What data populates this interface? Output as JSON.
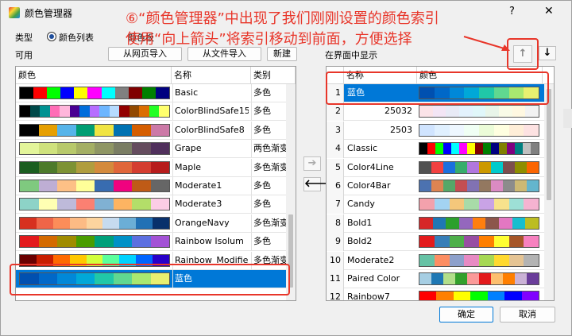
{
  "window": {
    "title": "颜色管理器",
    "help": "?",
    "close": "✕"
  },
  "annotation": {
    "line1": "⑥“颜色管理器”中出现了我们刚刚设置的颜色索引",
    "line2": "使用“向上箭头”将索引移动到前面，方便选择",
    "accent": "#e8362a"
  },
  "type_label": "类型",
  "radio_list": "颜色列表",
  "radio_board": "颜色板",
  "available_label": "可用",
  "buttons": {
    "import_web": "从网页导入",
    "import_file": "从文件导入",
    "new": "新建",
    "ok": "确定",
    "cancel": "取消"
  },
  "display_label": "在界面中显示",
  "left_table": {
    "headers": [
      "颜色",
      "名称",
      "类别"
    ],
    "rows": [
      {
        "name": "Basic",
        "cat": "多色",
        "colors": [
          "#000000",
          "#ff0000",
          "#00ff00",
          "#0000ff",
          "#ffff00",
          "#ff00ff",
          "#00ffff",
          "#808080",
          "#800000",
          "#008000",
          "#000080"
        ]
      },
      {
        "name": "ColorBlindSafe15",
        "cat": "多色",
        "colors": [
          "#000000",
          "#004949",
          "#009292",
          "#ff6db6",
          "#ffb6db",
          "#490092",
          "#006ddb",
          "#b66dff",
          "#6db6ff",
          "#b6dbff",
          "#920000",
          "#924900",
          "#db6d00",
          "#24ff24",
          "#ffff6d"
        ]
      },
      {
        "name": "ColorBlindSafe8",
        "cat": "多色",
        "colors": [
          "#000000",
          "#e69f00",
          "#56b4e9",
          "#009e73",
          "#f0e442",
          "#0072b2",
          "#d55e00",
          "#cc79a7"
        ]
      },
      {
        "name": "Grape",
        "cat": "两色渐变",
        "colors": [
          "#e3f59a",
          "#cfe27d",
          "#b8c96b",
          "#a4af64",
          "#8f9664",
          "#7a7d63",
          "#654c5e",
          "#50305c"
        ]
      },
      {
        "name": "Maple",
        "cat": "多色渐变",
        "colors": [
          "#1b5e20",
          "#4c7a2a",
          "#7d9234",
          "#b09d3e",
          "#d48a3c",
          "#e0663a",
          "#d43d30",
          "#b71c1c"
        ]
      },
      {
        "name": "Moderate1",
        "cat": "多色",
        "colors": [
          "#7fc97f",
          "#beaed4",
          "#fdc086",
          "#ffff99",
          "#386cb0",
          "#f0027f",
          "#bf5b17",
          "#666666"
        ]
      },
      {
        "name": "Moderate3",
        "cat": "多色",
        "colors": [
          "#8dd3c7",
          "#ffffb3",
          "#bebada",
          "#fb8072",
          "#80b1d3",
          "#fdb462",
          "#b3de69",
          "#fccde5"
        ]
      },
      {
        "name": "OrangeNavy",
        "cat": "多色渐变",
        "colors": [
          "#d7301f",
          "#ef6548",
          "#fc8d59",
          "#fdbb84",
          "#fdd49e",
          "#c6dbef",
          "#6baed6",
          "#2171b5",
          "#08306b"
        ]
      },
      {
        "name": "Rainbow Isolum",
        "cat": "多色",
        "colors": [
          "#e31a1c",
          "#d46a00",
          "#a08c00",
          "#4a9d00",
          "#00a07a",
          "#0091c7",
          "#5c6fe0",
          "#a352d6"
        ]
      },
      {
        "name": "Rainbow_Modified",
        "cat": "多色渐变",
        "colors": [
          "#6a0000",
          "#c81e00",
          "#ff6a00",
          "#ffc800",
          "#d2ff3c",
          "#5cff9c",
          "#00d2ff",
          "#0064ff",
          "#2800c8"
        ]
      },
      {
        "name": "蓝色",
        "cat": "",
        "selected": true,
        "colors": [
          "#0050b0",
          "#0068c8",
          "#0088d8",
          "#00a8d8",
          "#20c8a8",
          "#60d890",
          "#a8e870",
          "#e8f070"
        ]
      }
    ]
  },
  "right_table": {
    "headers": [
      "名称",
      "颜色"
    ],
    "rows": [
      {
        "idx": "1",
        "name": "蓝色",
        "selected": true,
        "colors": [
          "#0050b0",
          "#0068c8",
          "#0088d8",
          "#00a8d8",
          "#20c8a8",
          "#60d890",
          "#a8e870",
          "#e8f070"
        ]
      },
      {
        "idx": "2",
        "name": "25032",
        "right": true,
        "colors": [
          "#fbe3e8",
          "#f3e5f5",
          "#e8eaf6",
          "#e3f2fd",
          "#e0f7fa",
          "#e8f5e9",
          "#f9fbe7",
          "#fff8e1",
          "#f2f2f2"
        ]
      },
      {
        "idx": "3",
        "name": "2503",
        "right": true,
        "colors": [
          "#d0e4ff",
          "#e0f0ff",
          "#eef7ff",
          "#f0fff4",
          "#ecfcd8",
          "#ffffe0",
          "#ffeed8",
          "#fde2e2"
        ]
      },
      {
        "idx": "4",
        "name": "Classic",
        "colors": [
          "#000000",
          "#ff0000",
          "#00ff00",
          "#0000ff",
          "#00ffff",
          "#ff00ff",
          "#ffff00",
          "#800000",
          "#008000",
          "#000080",
          "#808000",
          "#800080",
          "#008080",
          "#c0c0c0",
          "#808080"
        ]
      },
      {
        "idx": "5",
        "name": "Color4Line",
        "colors": [
          "#515151",
          "#f14040",
          "#1a6fdf",
          "#37ad6b",
          "#b177de",
          "#cc9900",
          "#00cbcc",
          "#7d4e4e",
          "#8e8e00",
          "#fb6501"
        ]
      },
      {
        "idx": "6",
        "name": "Color4Bar",
        "colors": [
          "#4c72b0",
          "#dd8452",
          "#55a868",
          "#c44e52",
          "#8172b3",
          "#937860",
          "#da8bc3",
          "#8c8c8c",
          "#ccb974",
          "#64b5cd"
        ]
      },
      {
        "idx": "7",
        "name": "Candy",
        "colors": [
          "#f3a1ac",
          "#a3d3f2",
          "#f4c77b",
          "#a8dba8",
          "#c9a3e6",
          "#f7e28c",
          "#9de0d6",
          "#f5b3d1"
        ]
      },
      {
        "idx": "8",
        "name": "Bold1",
        "colors": [
          "#d62728",
          "#1f77b4",
          "#2ca02c",
          "#9467bd",
          "#ff7f0e",
          "#8c564b",
          "#e377c2",
          "#17becf",
          "#bcbd22"
        ]
      },
      {
        "idx": "9",
        "name": "Bold2",
        "colors": [
          "#e41a1c",
          "#377eb8",
          "#4daf4a",
          "#984ea3",
          "#ff7f00",
          "#ffff33",
          "#a65628",
          "#f781bf"
        ]
      },
      {
        "idx": "10",
        "name": "Moderate2",
        "colors": [
          "#66c2a5",
          "#fc8d62",
          "#8da0cb",
          "#e78ac3",
          "#a6d854",
          "#ffd92f",
          "#e5c494",
          "#b3b3b3"
        ]
      },
      {
        "idx": "11",
        "name": "Paired Color",
        "colors": [
          "#a6cee3",
          "#1f78b4",
          "#b2df8a",
          "#33a02c",
          "#fb9a99",
          "#e31a1c",
          "#fdbf6f",
          "#ff7f00",
          "#cab2d6",
          "#6a3d9a"
        ]
      },
      {
        "idx": "12",
        "name": "Rainbow7",
        "colors": [
          "#ff0000",
          "#ff8000",
          "#ffff00",
          "#00ff00",
          "#0080ff",
          "#0000ff",
          "#8000ff"
        ]
      }
    ]
  },
  "move_right_icon": "➔",
  "move_left_icon": "🡐",
  "up_icon": "↑",
  "down_icon": "↓"
}
